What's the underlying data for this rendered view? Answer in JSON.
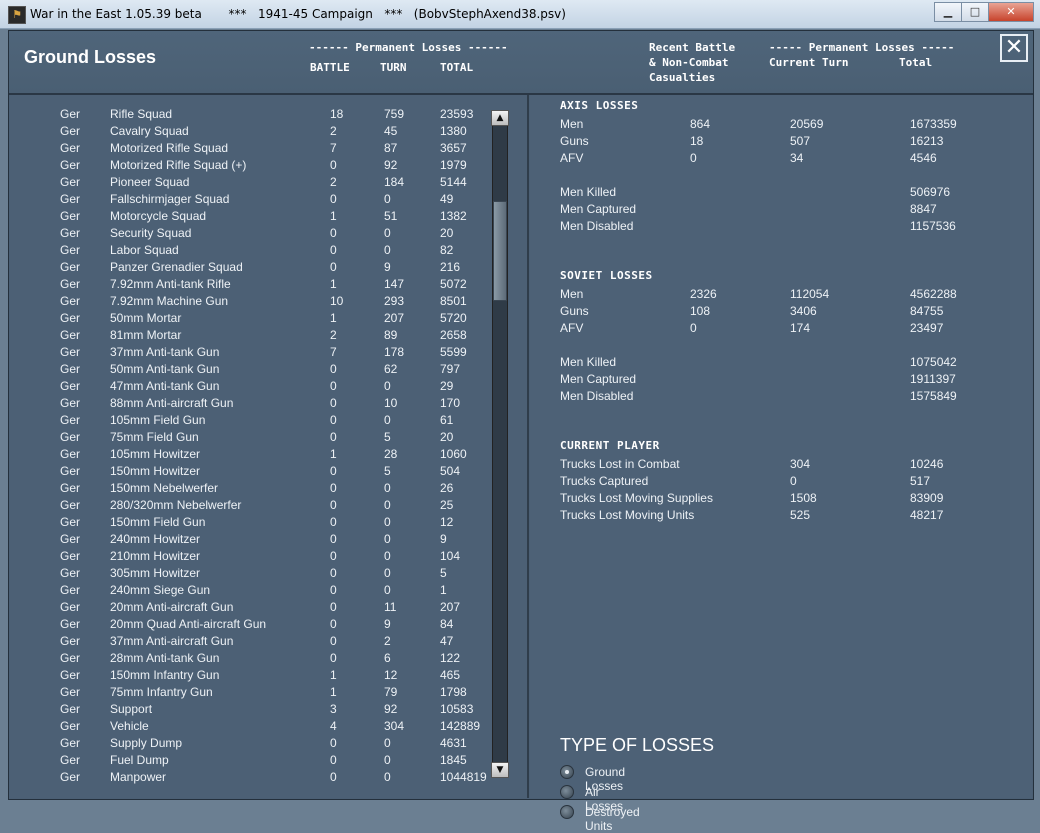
{
  "window": {
    "title": "War in the East 1.05.39 beta       ***   1941-45 Campaign   ***   (BobvStephAxend38.psv)",
    "icon": "app-icon",
    "controls": [
      "minimize-icon",
      "maximize-icon",
      "close-icon"
    ]
  },
  "header": {
    "title": "Ground Losses",
    "perm_losses_left": "------ Permanent Losses ------",
    "col_battle": "BATTLE",
    "col_turn": "TURN",
    "col_total": "TOTAL",
    "recent_line1": "Recent Battle",
    "recent_line2": "& Non-Combat",
    "recent_line3": "Casualties",
    "perm_losses_right": "----- Permanent Losses -----",
    "current_turn": "Current Turn",
    "total": "Total",
    "close_glyph": "✕"
  },
  "ground_list": [
    {
      "side": "Ger",
      "name": "Rifle Squad",
      "battle": "18",
      "turn": "759",
      "total": "23593"
    },
    {
      "side": "Ger",
      "name": "Cavalry Squad",
      "battle": "2",
      "turn": "45",
      "total": "1380"
    },
    {
      "side": "Ger",
      "name": "Motorized Rifle Squad",
      "battle": "7",
      "turn": "87",
      "total": "3657"
    },
    {
      "side": "Ger",
      "name": "Motorized Rifle Squad (+)",
      "battle": "0",
      "turn": "92",
      "total": "1979"
    },
    {
      "side": "Ger",
      "name": "Pioneer Squad",
      "battle": "2",
      "turn": "184",
      "total": "5144"
    },
    {
      "side": "Ger",
      "name": "Fallschirmjager Squad",
      "battle": "0",
      "turn": "0",
      "total": "49"
    },
    {
      "side": "Ger",
      "name": "Motorcycle Squad",
      "battle": "1",
      "turn": "51",
      "total": "1382"
    },
    {
      "side": "Ger",
      "name": "Security Squad",
      "battle": "0",
      "turn": "0",
      "total": "20"
    },
    {
      "side": "Ger",
      "name": "Labor Squad",
      "battle": "0",
      "turn": "0",
      "total": "82"
    },
    {
      "side": "Ger",
      "name": "Panzer Grenadier Squad",
      "battle": "0",
      "turn": "9",
      "total": "216"
    },
    {
      "side": "Ger",
      "name": "7.92mm Anti-tank Rifle",
      "battle": "1",
      "turn": "147",
      "total": "5072"
    },
    {
      "side": "Ger",
      "name": "7.92mm Machine Gun",
      "battle": "10",
      "turn": "293",
      "total": "8501"
    },
    {
      "side": "Ger",
      "name": "50mm Mortar",
      "battle": "1",
      "turn": "207",
      "total": "5720"
    },
    {
      "side": "Ger",
      "name": "81mm Mortar",
      "battle": "2",
      "turn": "89",
      "total": "2658"
    },
    {
      "side": "Ger",
      "name": "37mm Anti-tank Gun",
      "battle": "7",
      "turn": "178",
      "total": "5599"
    },
    {
      "side": "Ger",
      "name": "50mm Anti-tank Gun",
      "battle": "0",
      "turn": "62",
      "total": "797"
    },
    {
      "side": "Ger",
      "name": "47mm Anti-tank Gun",
      "battle": "0",
      "turn": "0",
      "total": "29"
    },
    {
      "side": "Ger",
      "name": "88mm Anti-aircraft Gun",
      "battle": "0",
      "turn": "10",
      "total": "170"
    },
    {
      "side": "Ger",
      "name": "105mm Field Gun",
      "battle": "0",
      "turn": "0",
      "total": "61"
    },
    {
      "side": "Ger",
      "name": "75mm Field Gun",
      "battle": "0",
      "turn": "5",
      "total": "20"
    },
    {
      "side": "Ger",
      "name": "105mm Howitzer",
      "battle": "1",
      "turn": "28",
      "total": "1060"
    },
    {
      "side": "Ger",
      "name": "150mm Howitzer",
      "battle": "0",
      "turn": "5",
      "total": "504"
    },
    {
      "side": "Ger",
      "name": "150mm Nebelwerfer",
      "battle": "0",
      "turn": "0",
      "total": "26"
    },
    {
      "side": "Ger",
      "name": "280/320mm Nebelwerfer",
      "battle": "0",
      "turn": "0",
      "total": "25"
    },
    {
      "side": "Ger",
      "name": "150mm Field Gun",
      "battle": "0",
      "turn": "0",
      "total": "12"
    },
    {
      "side": "Ger",
      "name": "240mm Howitzer",
      "battle": "0",
      "turn": "0",
      "total": "9"
    },
    {
      "side": "Ger",
      "name": "210mm Howitzer",
      "battle": "0",
      "turn": "0",
      "total": "104"
    },
    {
      "side": "Ger",
      "name": "305mm Howitzer",
      "battle": "0",
      "turn": "0",
      "total": "5"
    },
    {
      "side": "Ger",
      "name": "240mm Siege Gun",
      "battle": "0",
      "turn": "0",
      "total": "1"
    },
    {
      "side": "Ger",
      "name": "20mm Anti-aircraft Gun",
      "battle": "0",
      "turn": "11",
      "total": "207"
    },
    {
      "side": "Ger",
      "name": "20mm Quad Anti-aircraft Gun",
      "battle": "0",
      "turn": "9",
      "total": "84"
    },
    {
      "side": "Ger",
      "name": "37mm Anti-aircraft Gun",
      "battle": "0",
      "turn": "2",
      "total": "47"
    },
    {
      "side": "Ger",
      "name": "28mm Anti-tank Gun",
      "battle": "0",
      "turn": "6",
      "total": "122"
    },
    {
      "side": "Ger",
      "name": "150mm Infantry Gun",
      "battle": "1",
      "turn": "12",
      "total": "465"
    },
    {
      "side": "Ger",
      "name": "75mm Infantry Gun",
      "battle": "1",
      "turn": "79",
      "total": "1798"
    },
    {
      "side": "Ger",
      "name": "Support",
      "battle": "3",
      "turn": "92",
      "total": "10583"
    },
    {
      "side": "Ger",
      "name": "Vehicle",
      "battle": "4",
      "turn": "304",
      "total": "142889"
    },
    {
      "side": "Ger",
      "name": "Supply Dump",
      "battle": "0",
      "turn": "0",
      "total": "4631"
    },
    {
      "side": "Ger",
      "name": "Fuel Dump",
      "battle": "0",
      "turn": "0",
      "total": "1845"
    },
    {
      "side": "Ger",
      "name": "Manpower",
      "battle": "0",
      "turn": "0",
      "total": "1044819"
    }
  ],
  "axis": {
    "title": "AXIS LOSSES",
    "rows": [
      {
        "label": "Men",
        "recent": "864",
        "turn": "20569",
        "total": "1673359"
      },
      {
        "label": "Guns",
        "recent": "18",
        "turn": "507",
        "total": "16213"
      },
      {
        "label": "AFV",
        "recent": "0",
        "turn": "34",
        "total": "4546"
      }
    ],
    "details": [
      {
        "label": "Men Killed",
        "total": "506976"
      },
      {
        "label": "Men Captured",
        "total": "8847"
      },
      {
        "label": "Men Disabled",
        "total": "1157536"
      }
    ]
  },
  "soviet": {
    "title": "SOVIET LOSSES",
    "rows": [
      {
        "label": "Men",
        "recent": "2326",
        "turn": "112054",
        "total": "4562288"
      },
      {
        "label": "Guns",
        "recent": "108",
        "turn": "3406",
        "total": "84755"
      },
      {
        "label": "AFV",
        "recent": "0",
        "turn": "174",
        "total": "23497"
      }
    ],
    "details": [
      {
        "label": "Men Killed",
        "total": "1075042"
      },
      {
        "label": "Men Captured",
        "total": "1911397"
      },
      {
        "label": "Men Disabled",
        "total": "1575849"
      }
    ]
  },
  "player": {
    "title": "CURRENT PLAYER",
    "rows": [
      {
        "label": "Trucks Lost in Combat",
        "turn": "304",
        "total": "10246"
      },
      {
        "label": "Trucks Captured",
        "turn": "0",
        "total": "517"
      },
      {
        "label": "Trucks Lost Moving Supplies",
        "turn": "1508",
        "total": "83909"
      },
      {
        "label": "Trucks Lost Moving Units",
        "turn": "525",
        "total": "48217"
      }
    ]
  },
  "type_of_losses": {
    "title": "TYPE OF LOSSES",
    "options": [
      {
        "label": "Ground Losses",
        "selected": true
      },
      {
        "label": "Air Losses",
        "selected": false
      },
      {
        "label": "Destroyed Units",
        "selected": false
      }
    ]
  },
  "scrollbar": {
    "up_glyph": "▲",
    "down_glyph": "▼"
  }
}
